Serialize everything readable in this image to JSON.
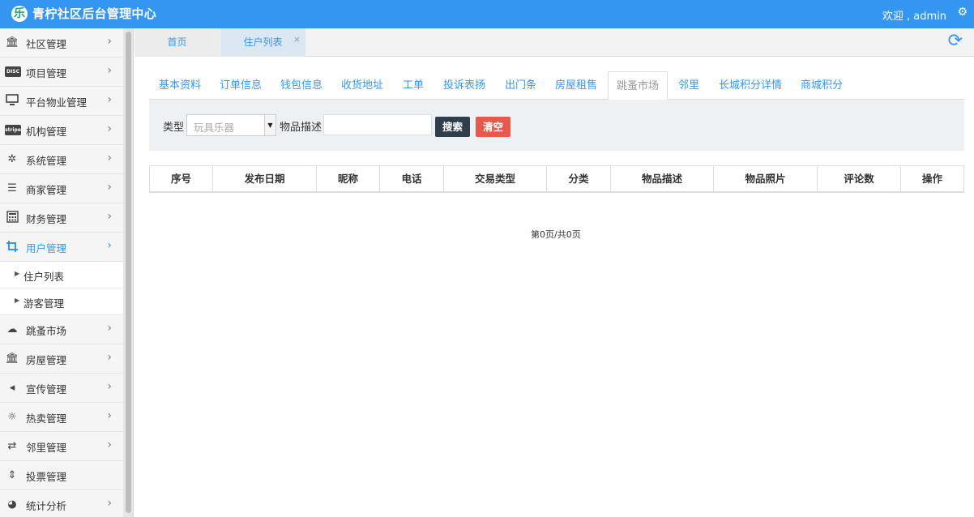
{
  "header": {
    "logo_glyph": "乐",
    "title": "青柠社区后台管理中心",
    "welcome": "欢迎 , admin",
    "settings_icon": "gear-icon"
  },
  "sidebar": {
    "items": [
      {
        "label": "社区管理",
        "icon": "bank-icon"
      },
      {
        "label": "项目管理",
        "icon": "discover-card-icon"
      },
      {
        "label": "平台物业管理",
        "icon": "desktop-icon"
      },
      {
        "label": "机构管理",
        "icon": "stripe-icon"
      },
      {
        "label": "系统管理",
        "icon": "yelp-icon"
      },
      {
        "label": "商家管理",
        "icon": "bars-icon"
      },
      {
        "label": "财务管理",
        "icon": "calculator-icon"
      },
      {
        "label": "用户管理",
        "icon": "crop-icon",
        "active": true
      },
      {
        "label": "跳蚤市场",
        "icon": "cloud-icon"
      },
      {
        "label": "房屋管理",
        "icon": "bank-icon"
      },
      {
        "label": "宣传管理",
        "icon": "volume-icon"
      },
      {
        "label": "热卖管理",
        "icon": "sun-icon"
      },
      {
        "label": "邻里管理",
        "icon": "retweet-icon"
      },
      {
        "label": "投票管理",
        "icon": "sort-icon"
      },
      {
        "label": "统计分析",
        "icon": "pie-chart-icon"
      }
    ],
    "sub_items": [
      "住户列表",
      "游客管理"
    ]
  },
  "page_tabs": {
    "home": "首页",
    "current": "住户列表",
    "close": "×"
  },
  "content_tabs": [
    "基本资料",
    "订单信息",
    "钱包信息",
    "收货地址",
    "工单",
    "投诉表扬",
    "出门条",
    "房屋租售",
    "跳蚤市场",
    "邻里",
    "长城积分详情",
    "商城积分"
  ],
  "active_content_tab": "跳蚤市场",
  "search": {
    "type_label": "类型",
    "type_value": "玩具乐器",
    "desc_label": "物品描述",
    "desc_value": "",
    "search_button": "搜索",
    "clear_button": "清空"
  },
  "table": {
    "columns": [
      "序号",
      "发布日期",
      "昵称",
      "电话",
      "交易类型",
      "分类",
      "物品描述",
      "物品照片",
      "评论数",
      "操作"
    ],
    "rows": []
  },
  "pager": "第0页/共0页",
  "colors": {
    "primary": "#3596f2",
    "search_button": "#2f3e4c",
    "clear_button": "#e8584c"
  }
}
